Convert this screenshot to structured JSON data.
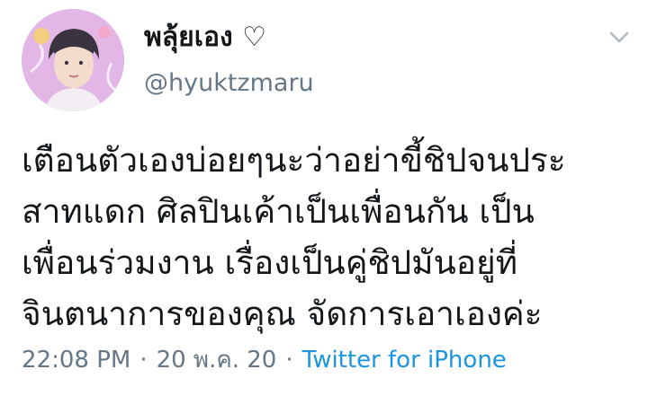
{
  "user": {
    "display_name": "พลุ้ยเอง ♡",
    "handle": "@hyuktzmaru",
    "avatar_icon": "user-avatar"
  },
  "tweet": {
    "lines": [
      "เตือนตัวเองบ่อยๆนะว่าอย่าขี้ชิปจนประ",
      "สาทแดก ศิลปินเค้าเป็นเพื่อนกัน เป็น",
      "เพื่อนร่วมงาน เรื่องเป็นคู่ชิปมันอยู่ที่",
      "จินตนาการของคุณ จัดการเอาเองค่ะ"
    ],
    "time": "22:08 PM",
    "date": "20 พ.ค. 20",
    "separator": "·",
    "source": "Twitter for iPhone"
  },
  "colors": {
    "text": "#14171a",
    "secondary": "#657786",
    "link": "#1b95e0",
    "caret": "#aab8c2"
  },
  "icons": {
    "menu": "chevron-down-icon"
  }
}
